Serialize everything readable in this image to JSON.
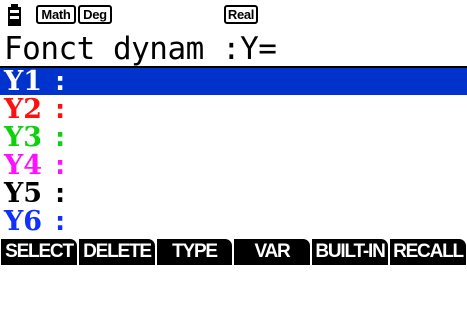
{
  "status_bar": {
    "battery_icon": "battery-icon",
    "mode_math": "Math",
    "mode_angle": "Deg",
    "mode_complex": "Real"
  },
  "screen": {
    "title": "Fonct dynam :Y="
  },
  "functions": [
    {
      "name": "Y1",
      "separator": ":",
      "color": "#ffffff",
      "selected": true
    },
    {
      "name": "Y2",
      "separator": ":",
      "color": "#ff1010",
      "selected": false
    },
    {
      "name": "Y3",
      "separator": ":",
      "color": "#10d010",
      "selected": false
    },
    {
      "name": "Y4",
      "separator": ":",
      "color": "#ff10ff",
      "selected": false
    },
    {
      "name": "Y5",
      "separator": ":",
      "color": "#000000",
      "selected": false
    },
    {
      "name": "Y6",
      "separator": ":",
      "color": "#1030ff",
      "selected": false
    }
  ],
  "selection_color": "#0033cc",
  "function_keys": [
    {
      "label": "SELECT"
    },
    {
      "label": "DELETE"
    },
    {
      "label": "TYPE"
    },
    {
      "label": "VAR"
    },
    {
      "label": "BUILT-IN"
    },
    {
      "label": "RECALL"
    }
  ]
}
